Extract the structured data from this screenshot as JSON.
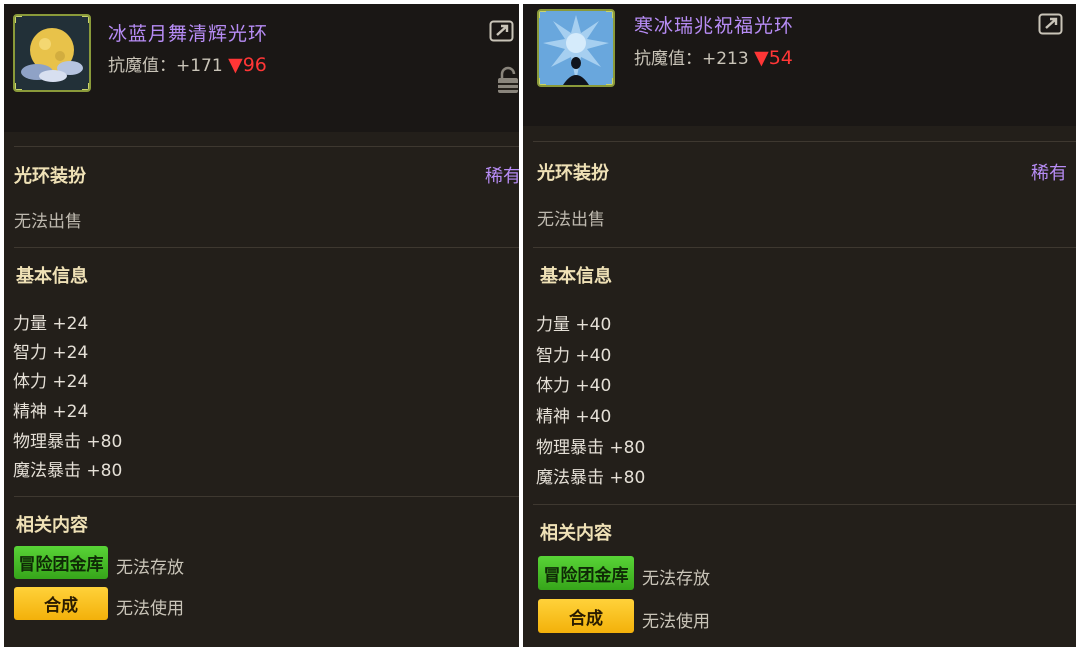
{
  "left": {
    "name": "冰蓝月舞清辉光环",
    "resist_label": "抗魔值：",
    "resist_value": "+171",
    "resist_delta": "▼96",
    "category": "光环装扮",
    "rarity": "稀有",
    "sell_status": "无法出售",
    "section_basic": "基本信息",
    "stats": [
      "力量 +24",
      "智力 +24",
      "体力 +24",
      "精神 +24",
      "物理暴击 +80",
      "魔法暴击 +80"
    ],
    "section_related": "相关内容",
    "bank_button": "冒险团金库",
    "bank_note": "无法存放",
    "craft_button": "合成",
    "craft_note": "无法使用",
    "icons": [
      "moon-aura-icon",
      "share-icon",
      "lock-icon"
    ]
  },
  "right": {
    "name": "寒冰瑞兆祝福光环",
    "resist_label": "抗魔值：",
    "resist_value": "+213",
    "resist_delta": "▼54",
    "category": "光环装扮",
    "rarity": "稀有",
    "sell_status": "无法出售",
    "section_basic": "基本信息",
    "stats": [
      "力量 +40",
      "智力 +40",
      "体力 +40",
      "精神 +40",
      "物理暴击 +80",
      "魔法暴击 +80"
    ],
    "section_related": "相关内容",
    "bank_button": "冒险团金库",
    "bank_note": "无法存放",
    "craft_button": "合成",
    "craft_note": "无法使用",
    "icons": [
      "ice-aura-icon",
      "share-icon"
    ]
  },
  "colors": {
    "panel_bg": "#231f1a",
    "rare_purple": "#b78cf5",
    "label_gold": "#efe1b6",
    "down_red": "#ff3636",
    "bank_green": "#45c12a",
    "craft_gold": "#f9c21e"
  }
}
